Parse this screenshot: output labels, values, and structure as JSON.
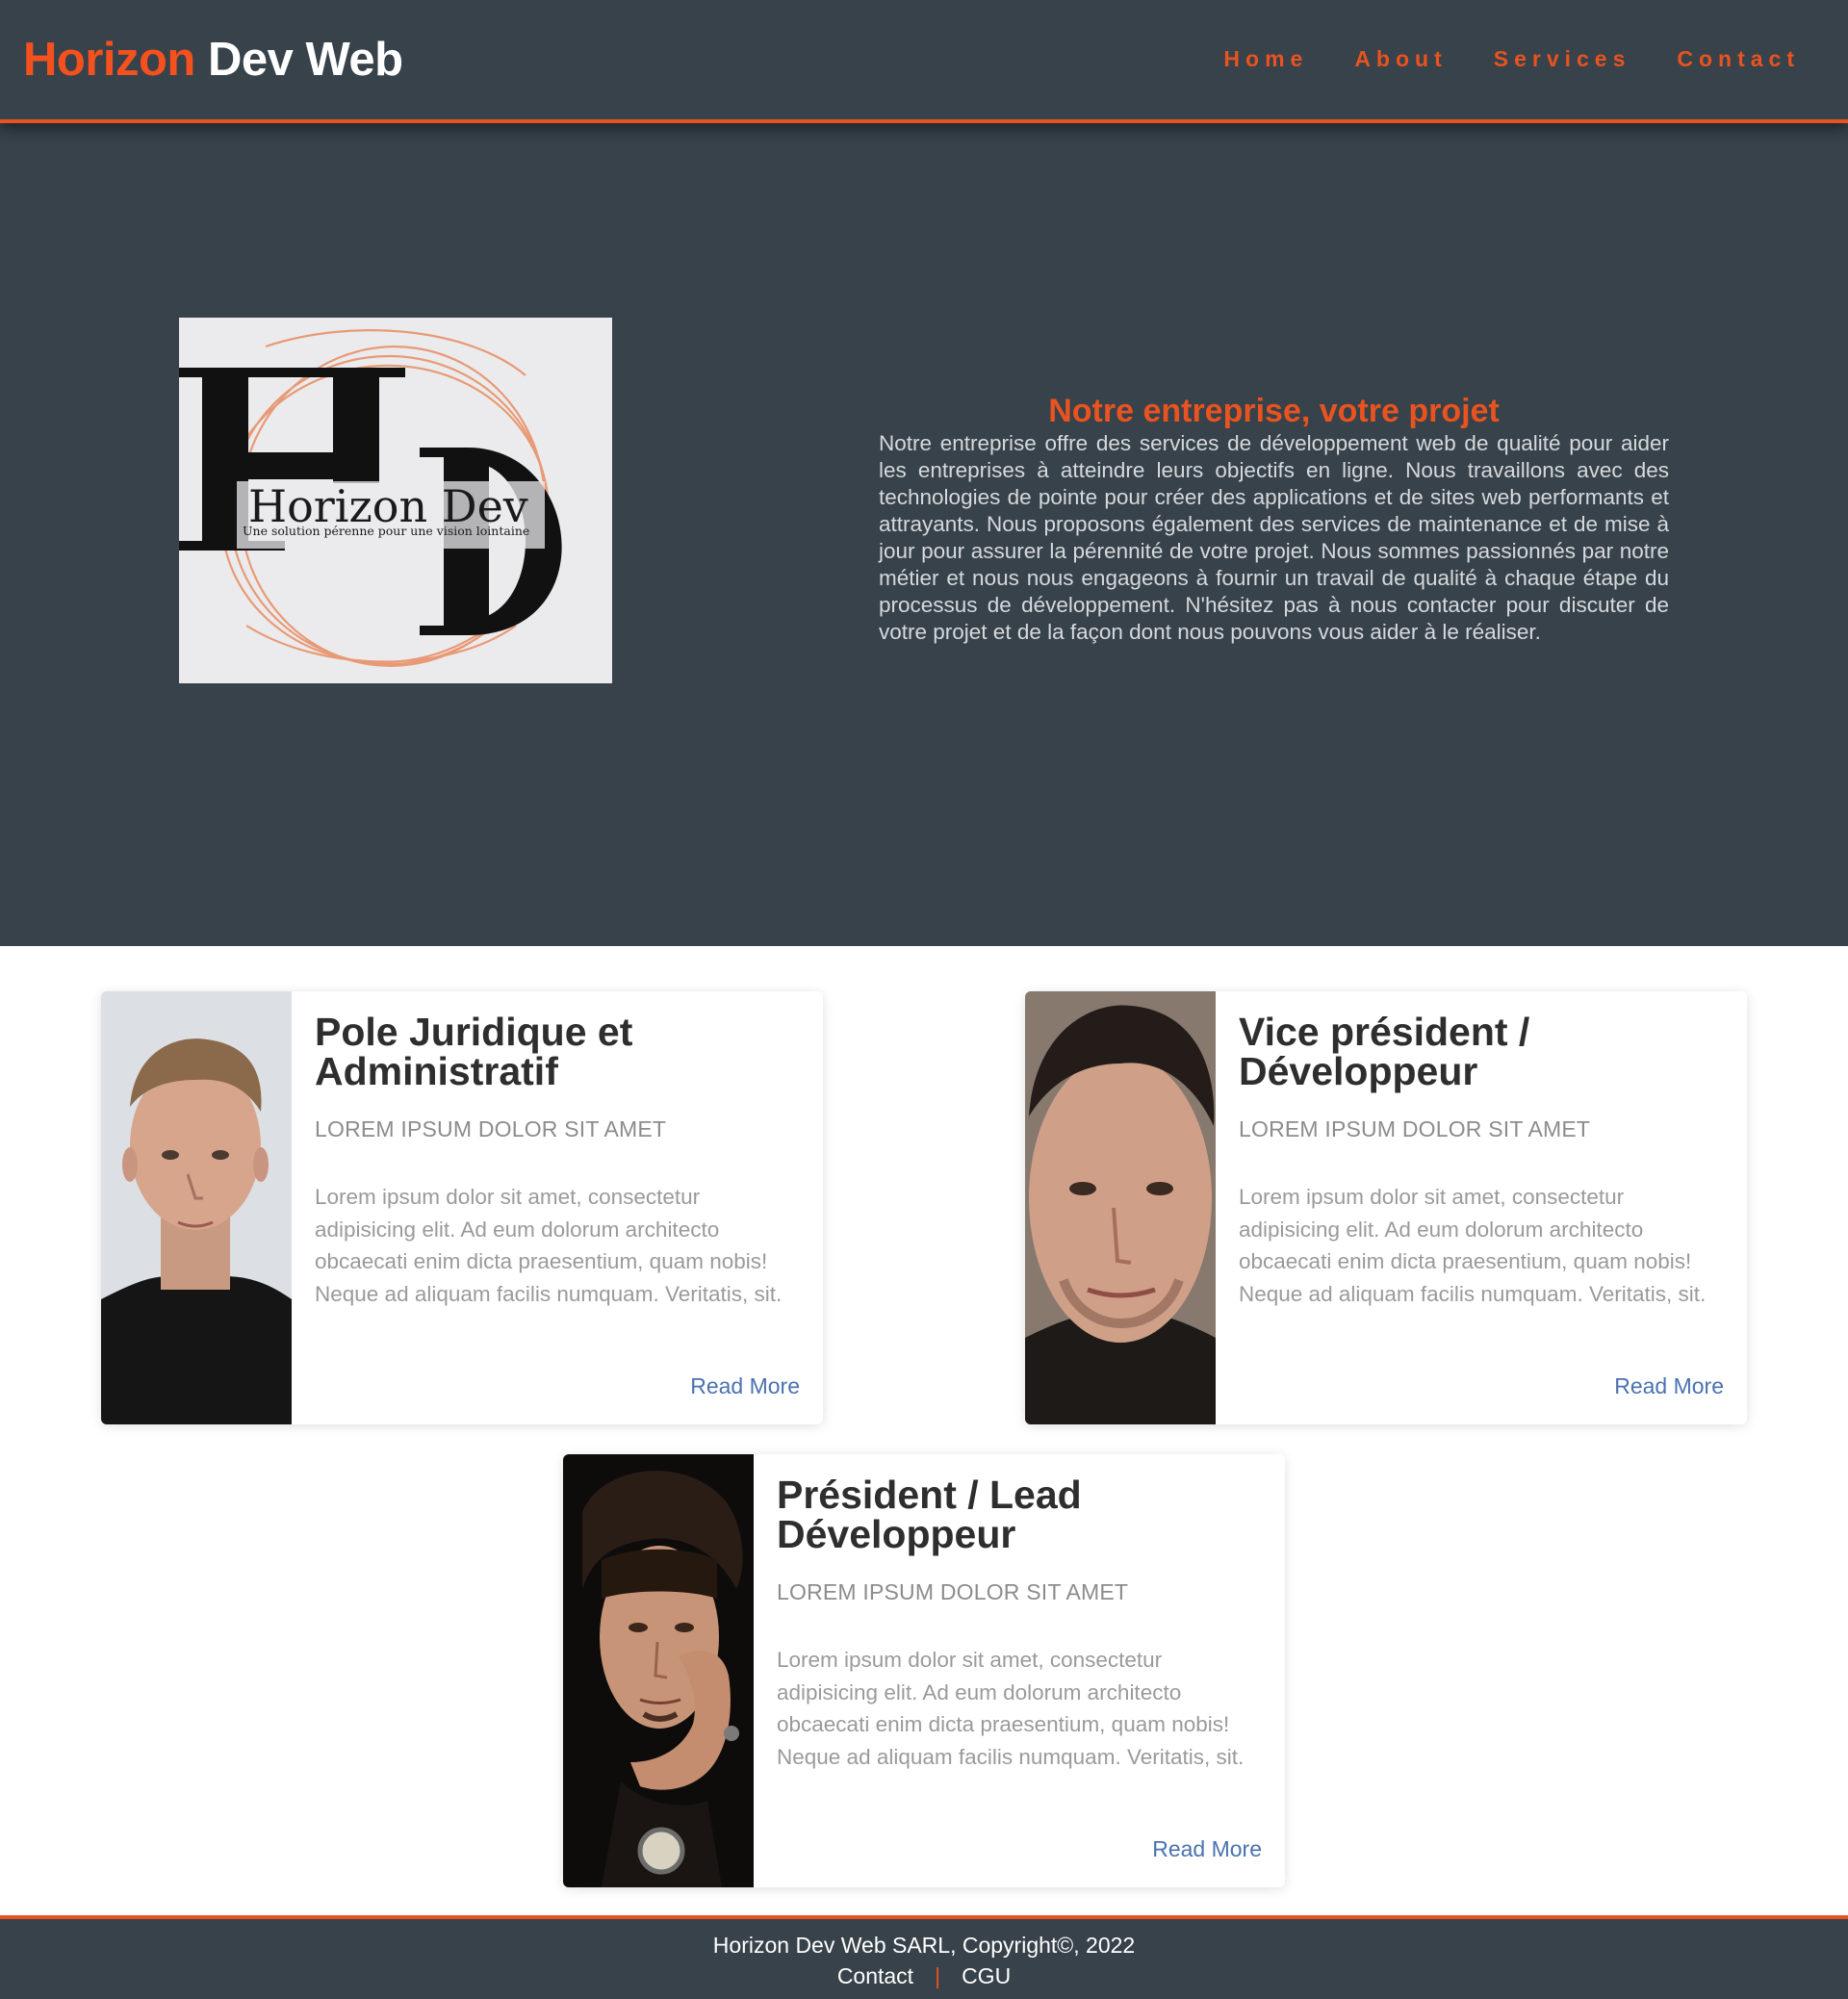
{
  "header": {
    "brand_accent": "Horizon",
    "brand_rest": " Dev Web",
    "nav": [
      "Home",
      "About",
      "Services",
      "Contact"
    ]
  },
  "hero": {
    "logo": {
      "name": "Horizon Dev",
      "tagline": "Une solution pérenne pour une vision lointaine"
    },
    "title": "Notre entreprise, votre projet",
    "body": "Notre entreprise offre des services de développement web de qualité pour aider les entreprises à atteindre leurs objectifs en ligne. Nous travaillons avec des technologies de pointe pour créer des applications et de sites web performants et attrayants. Nous proposons également des services de maintenance et de mise à jour pour assurer la pérennité de votre projet. Nous sommes passionnés par notre métier et nous nous engageons à fournir un travail de qualité à chaque étape du processus de développement. N'hésitez pas à nous contacter pour discuter de votre projet et de la façon dont nous pouvons vous aider à le réaliser."
  },
  "cards": [
    {
      "title": "Pole Juridique et Administratif",
      "subtitle": "LOREM IPSUM DOLOR SIT AMET",
      "text": "Lorem ipsum dolor sit amet, consectetur adipisicing elit. Ad eum dolorum architecto obcaecati enim dicta praesentium, quam nobis! Neque ad aliquam facilis numquam. Veritatis, sit.",
      "link": "Read More"
    },
    {
      "title": "Vice président / Développeur",
      "subtitle": "LOREM IPSUM DOLOR SIT AMET",
      "text": "Lorem ipsum dolor sit amet, consectetur adipisicing elit. Ad eum dolorum architecto obcaecati enim dicta praesentium, quam nobis! Neque ad aliquam facilis numquam. Veritatis, sit.",
      "link": "Read More"
    },
    {
      "title": "Président / Lead Développeur",
      "subtitle": "LOREM IPSUM DOLOR SIT AMET",
      "text": "Lorem ipsum dolor sit amet, consectetur adipisicing elit. Ad eum dolorum architecto obcaecati enim dicta praesentium, quam nobis! Neque ad aliquam facilis numquam. Veritatis, sit.",
      "link": "Read More"
    }
  ],
  "footer": {
    "copyright": "Horizon Dev Web SARL, Copyright©, 2022",
    "links": [
      "Contact",
      "CGU"
    ],
    "separator": "|"
  },
  "colors": {
    "dark": "#37424a",
    "accent": "#e8531f",
    "link": "#4a72b0"
  }
}
